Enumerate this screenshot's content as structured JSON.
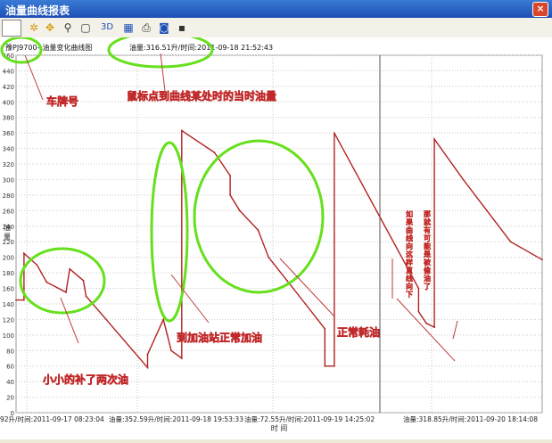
{
  "window": {
    "title": "油量曲线报表",
    "close_glyph": "×"
  },
  "toolbar": {
    "icons": [
      "gear-icon",
      "move-icon",
      "zoom-icon",
      "page-icon",
      "3d-icon",
      "chart-edit-icon",
      "print-icon",
      "export-icon",
      "save-icon"
    ],
    "threed_label": "3D"
  },
  "header": {
    "plate_title": "豫PJ9700--油量变化曲线图",
    "cursor_readout": "油量:316.51升/时间:2011-09-18 21:52:43"
  },
  "annotations": {
    "plate": "车牌号",
    "cursor": "鼠标点到曲线某处时的当时油量",
    "small_refuel": "小小的补了两次油",
    "station_refuel": "到加油站正常加油",
    "normal_use": "正常耗油",
    "theft_note_a": "如果曲线向这样直线向下",
    "theft_note_b": "那就有可能是被偷油了"
  },
  "chart_data": {
    "type": "line",
    "title": "豫PJ9700--油量变化曲线图",
    "xlabel": "时 间",
    "ylabel": "油量",
    "ylim": [
      0,
      460
    ],
    "yticks": [
      0,
      20,
      40,
      60,
      80,
      100,
      120,
      140,
      160,
      180,
      200,
      220,
      240,
      260,
      280,
      300,
      320,
      340,
      360,
      380,
      400,
      420,
      440,
      460
    ],
    "xticks": [
      "92升/时间:2011-09-17 08:23:04",
      "油量:352.59升/时间:2011-09-18 19:53:33",
      "油量:72.55升/时间:2011-09-19 14:25:02",
      "油量:318.85升/时间:2011-09-20 18:14:08"
    ],
    "xlim": [
      0,
      100
    ],
    "series": [
      {
        "color": "#b22222",
        "x": [
          0,
          1.5,
          1.5,
          4,
          5.8,
          9.5,
          10.2,
          12.8,
          13.3,
          25,
          25,
          28,
          29.5,
          31.5,
          31.5,
          37.7,
          40.7,
          40.7,
          42.5,
          46,
          48,
          51.5,
          55,
          58.7,
          58.7,
          60.5,
          60.5,
          76.5,
          76.5,
          78,
          79.5,
          79.5,
          85,
          89.5,
          94,
          100
        ],
        "y": [
          145,
          145,
          205,
          190,
          168,
          155,
          185,
          170,
          150,
          58,
          75,
          120,
          80,
          70,
          363,
          335,
          305,
          280,
          260,
          235,
          200,
          170,
          140,
          108,
          60,
          60,
          360,
          160,
          130,
          115,
          110,
          352,
          300,
          260,
          220,
          197
        ]
      }
    ]
  }
}
